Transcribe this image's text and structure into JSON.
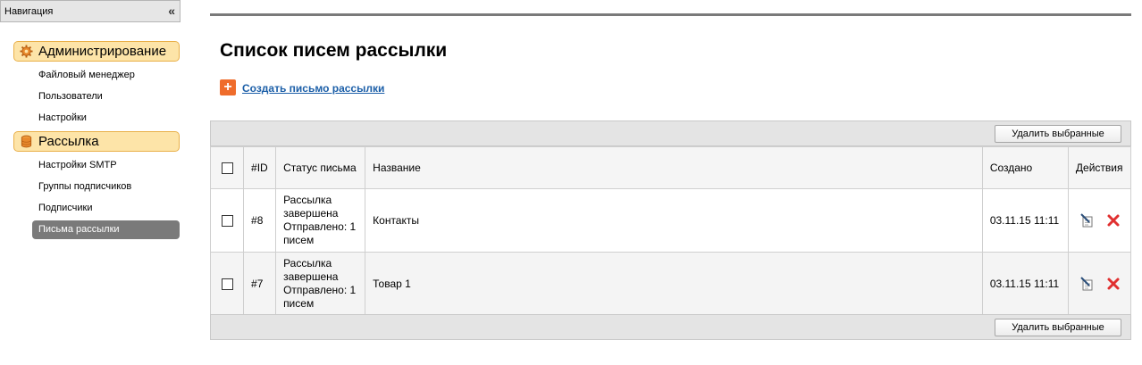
{
  "sidebar": {
    "header": "Навигация",
    "collapse": "«",
    "sections": [
      {
        "label": "Администрирование",
        "icon": "gear-icon",
        "items": [
          "Файловый менеджер",
          "Пользователи",
          "Настройки"
        ]
      },
      {
        "label": "Рассылка",
        "icon": "database-icon",
        "items": [
          "Настройки SMTP",
          "Группы подписчиков",
          "Подписчики",
          "Письма рассылки"
        ],
        "active_item": "Письма рассылки"
      }
    ]
  },
  "main": {
    "title": "Список писем рассылки",
    "create_icon": "+",
    "create_link": "Создать письмо рассылки",
    "delete_selected": "Удалить выбранные",
    "table": {
      "columns": [
        "#ID",
        "Статус письма",
        "Название",
        "Создано",
        "Действия"
      ],
      "rows": [
        {
          "id": "#8",
          "status_lines": [
            "Рассылка",
            "завершена",
            "Отправлено: 1",
            "писем"
          ],
          "name": "Контакты",
          "created": "03.11.15 11:11"
        },
        {
          "id": "#7",
          "status_lines": [
            "Рассылка",
            "завершена",
            "Отправлено: 1",
            "писем"
          ],
          "name": "Товар 1",
          "created": "03.11.15 11:11"
        }
      ]
    }
  },
  "colors": {
    "section_bg": "#fde4a8",
    "section_border": "#e9b04a",
    "active_item_bg": "#7a7a7a",
    "link": "#1c5fa8",
    "create_icon_bg": "#ef6c2b",
    "delete_icon": "#e03030"
  }
}
